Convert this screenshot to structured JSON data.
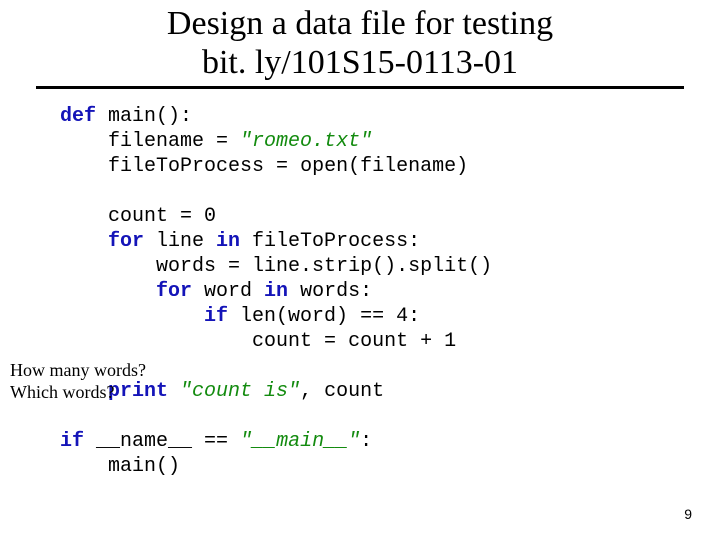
{
  "title": {
    "line1": "Design a data file for testing",
    "line2": "bit. ly/101S15-0113-01"
  },
  "code": {
    "l01_kw": "def",
    "l01_fn": " main():",
    "l02a": "    filename ",
    "l02_op": "=",
    "l02_str": " \"romeo.txt\"",
    "l03a": "    fileToProcess ",
    "l03_op": "=",
    "l03b": " open(filename)",
    "blank1": "",
    "l04a": "    count ",
    "l04_op": "=",
    "l04_num": " 0",
    "l05_kw": "    for",
    "l05a": " line ",
    "l05_kw2": "in",
    "l05b": " fileToProcess:",
    "l06a": "        words ",
    "l06_op": "=",
    "l06b": " line.strip().split()",
    "l07_kw": "        for",
    "l07a": " word ",
    "l07_kw2": "in",
    "l07b": " words:",
    "l08_kw": "            if",
    "l08a": " len(word) ",
    "l08_op": "==",
    "l08_num": " 4",
    "l08b": ":",
    "l09a": "                count ",
    "l09_op": "=",
    "l09b": " count ",
    "l09_op2": "+",
    "l09_num": " 1",
    "blank2": "",
    "l10_kw": "    print",
    "l10_str": " \"count is\"",
    "l10b": ", count",
    "blank3": "",
    "l11_kw": "if",
    "l11a": " __name__ ",
    "l11_op": "==",
    "l11_str": " \"__main__\"",
    "l11b": ":",
    "l12": "    main()"
  },
  "annotation": {
    "line1": "How many words?",
    "line2": "Which words?"
  },
  "page_number": "9"
}
